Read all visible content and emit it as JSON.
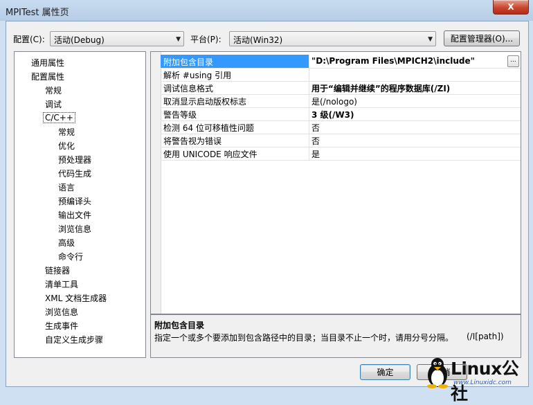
{
  "window": {
    "title": "MPITest 属性页",
    "close_glyph": "X"
  },
  "toolbar": {
    "config_label": "配置(C):",
    "config_value": "活动(Debug)",
    "platform_label": "平台(P):",
    "platform_value": "活动(Win32)",
    "config_manager_label": "配置管理器(O)..."
  },
  "tree": {
    "items": [
      {
        "label": "通用属性"
      },
      {
        "label": "配置属性"
      },
      {
        "label": "常规"
      },
      {
        "label": "调试"
      },
      {
        "label": "C/C++"
      },
      {
        "label": "常规"
      },
      {
        "label": "优化"
      },
      {
        "label": "预处理器"
      },
      {
        "label": "代码生成"
      },
      {
        "label": "语言"
      },
      {
        "label": "预编译头"
      },
      {
        "label": "输出文件"
      },
      {
        "label": "浏览信息"
      },
      {
        "label": "高级"
      },
      {
        "label": "命令行"
      },
      {
        "label": "链接器"
      },
      {
        "label": "清单工具"
      },
      {
        "label": "XML 文档生成器"
      },
      {
        "label": "浏览信息"
      },
      {
        "label": "生成事件"
      },
      {
        "label": "自定义生成步骤"
      }
    ]
  },
  "grid": {
    "rows": [
      {
        "name": "附加包含目录",
        "value": "\"D:\\Program Files\\MPICH2\\include\""
      },
      {
        "name": "解析 #using 引用",
        "value": ""
      },
      {
        "name": "调试信息格式",
        "value": "用于“编辑并继续”的程序数据库(/ZI)"
      },
      {
        "name": "取消显示启动版权标志",
        "value": "是(/nologo)"
      },
      {
        "name": "警告等级",
        "value": "3 级(/W3)"
      },
      {
        "name": "检测 64 位可移植性问题",
        "value": "否"
      },
      {
        "name": "将警告视为错误",
        "value": "否"
      },
      {
        "name": "使用 UNICODE 响应文件",
        "value": "是"
      }
    ],
    "ellipsis": "..."
  },
  "description": {
    "title": "附加包含目录",
    "text": "指定一个或多个要添加到包含路径中的目录；当目录不止一个时，请用分号分隔。",
    "hint": "(/I[path])"
  },
  "footer": {
    "ok_label": "确定",
    "cancel_label": "取消"
  },
  "watermark": {
    "brand": "Linux公社",
    "url": "www.Linuxidc.com"
  },
  "colors": {
    "selection": "#3399ff",
    "titlebar": "#c8dbf0",
    "close": "#c8462f"
  }
}
